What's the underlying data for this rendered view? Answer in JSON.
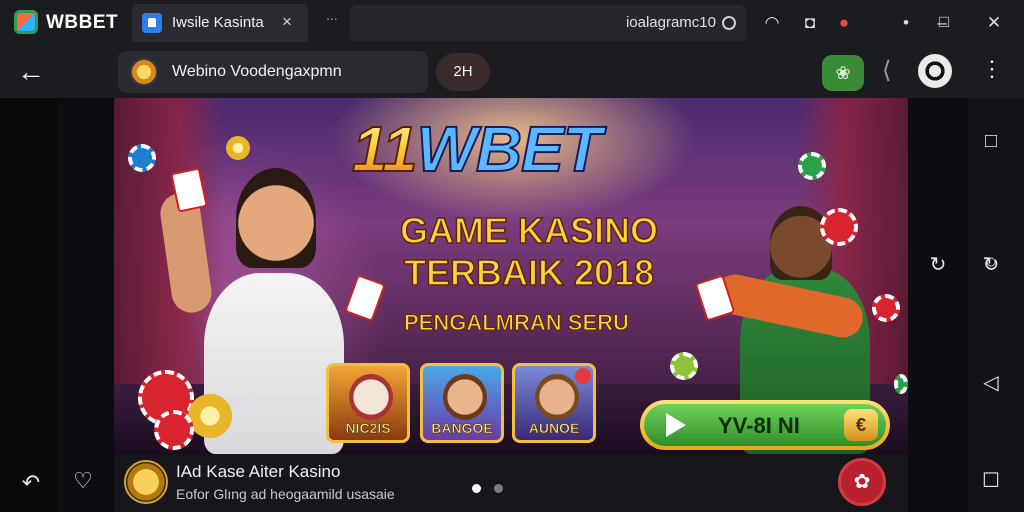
{
  "titlebar": {
    "app_name": "WBBET",
    "tab_title": "Iwsile Kasinta",
    "tab_close": "×",
    "new_tab": "∙∙∙",
    "address_text": "ioalagramc10",
    "icons": [
      "wifi-icon",
      "shield-icon",
      "record-icon",
      "menu-dot-icon",
      "minimize-icon",
      "maximize-icon",
      "close-icon"
    ]
  },
  "toolbar": {
    "back": "←",
    "url_text": "Webino Voodengaxpmn",
    "pill_text": "2H",
    "green_btn": "❀",
    "kebab": "⋮"
  },
  "banner": {
    "logo_11": "11",
    "logo_wbet": "WBET",
    "headline_1": "GAME KASINO",
    "headline_2": "TERBAIK 2018",
    "tagline": "PENGALMRAN SERU",
    "games": [
      "NIC2IS",
      "BANGOE",
      "AUNOE"
    ],
    "cta_label": "YV-8I NI",
    "cta_icon": "€"
  },
  "infobar": {
    "title": "IAd Kase Aiter Kasino",
    "subtitle": "Eofor Glıng ad heogaamild usasaie",
    "button_icon": "✿"
  },
  "right_rail": [
    "square-icon",
    "rotate-icon",
    "circle-icon",
    "triangle-back-icon",
    "note-icon"
  ],
  "bottom_left": [
    "undo-icon",
    "heart-icon"
  ]
}
